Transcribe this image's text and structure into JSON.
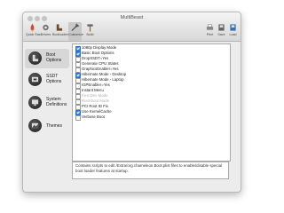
{
  "window": {
    "title": "MultiBeast"
  },
  "toolbar": {
    "left": [
      {
        "label": "Quick Start",
        "icon": "rocket-icon"
      },
      {
        "label": "Drivers",
        "icon": "gear-icon"
      },
      {
        "label": "Bootloaders",
        "icon": "boot-icon"
      },
      {
        "label": "Customize",
        "icon": "wrench-icon",
        "active": true
      },
      {
        "label": "Build",
        "icon": "hammer-icon"
      }
    ],
    "right": [
      {
        "label": "Print",
        "icon": "print-icon"
      },
      {
        "label": "Save",
        "icon": "save-icon"
      },
      {
        "label": "Load",
        "icon": "load-icon"
      }
    ]
  },
  "sidebar": {
    "items": [
      {
        "label": "Boot Options",
        "icon": "boot-options-icon",
        "selected": true
      },
      {
        "label": "SSDT Options",
        "icon": "ssdt-options-icon",
        "selected": false
      },
      {
        "label": "System Definitions",
        "icon": "system-definitions-icon",
        "selected": false
      },
      {
        "label": "Themes",
        "icon": "themes-icon",
        "selected": false
      }
    ]
  },
  "options": [
    {
      "label": "1080p Display Mode",
      "checked": true,
      "disabled": false
    },
    {
      "label": "Basic Boot Options",
      "checked": true,
      "disabled": false
    },
    {
      "label": "DropSSDT=Yes",
      "checked": false,
      "disabled": false
    },
    {
      "label": "Generate CPU States",
      "checked": false,
      "disabled": false
    },
    {
      "label": "GraphicsEnabler=Yes",
      "checked": false,
      "disabled": false
    },
    {
      "label": "Hibernate Mode - Desktop",
      "checked": true,
      "disabled": false
    },
    {
      "label": "Hibernate Mode - Laptop",
      "checked": false,
      "disabled": false
    },
    {
      "label": "IGPEnabler=Yes",
      "checked": false,
      "disabled": false
    },
    {
      "label": "Instant Menu",
      "checked": false,
      "disabled": false
    },
    {
      "label": "Kext Dev Mode",
      "checked": false,
      "disabled": true
    },
    {
      "label": "Root Boot Mode",
      "checked": false,
      "disabled": true
    },
    {
      "label": "PCI Root ID Fix",
      "checked": false,
      "disabled": false
    },
    {
      "label": "Use KernelCache",
      "checked": true,
      "disabled": false
    },
    {
      "label": "Verbose Boot",
      "checked": false,
      "disabled": false
    }
  ],
  "description": "Contains scripts to edit /Extra/org.chameleon.Boot.plist files to enable/disable special boot loader features at startup.",
  "colors": {
    "accent": "#3b86e0",
    "window_bg": "#ececec",
    "sidebar_selected": "#d7d7d7"
  }
}
